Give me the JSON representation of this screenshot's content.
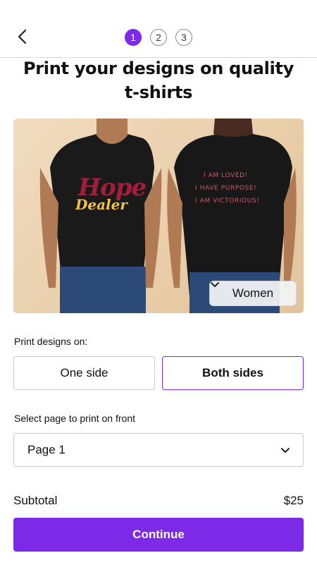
{
  "header": {
    "back_icon": "chevron-left-icon",
    "steps": [
      "1",
      "2",
      "3"
    ],
    "active_step": 1
  },
  "title": "Print your designs on quality t-shirts",
  "preview": {
    "front_design": {
      "line1": "Hope",
      "line2": "Dealer"
    },
    "back_design": [
      "I AM LOVED!",
      "I HAVE PURPOSE!",
      "I AM VICTORIOUS!"
    ],
    "fit_selector": {
      "value": "Women",
      "icon": "chevron-down-icon"
    }
  },
  "print_options": {
    "label": "Print designs on:",
    "one_side": "One side",
    "both_sides": "Both sides",
    "selected": "Both sides"
  },
  "page_select": {
    "label": "Select page to print on front",
    "value": "Page 1",
    "icon": "chevron-down-icon"
  },
  "subtotal": {
    "label": "Subtotal",
    "value": "$25"
  },
  "continue_label": "Continue",
  "colors": {
    "accent": "#7d2ae8",
    "shirt": "#151515",
    "background": "#e8cda8"
  }
}
